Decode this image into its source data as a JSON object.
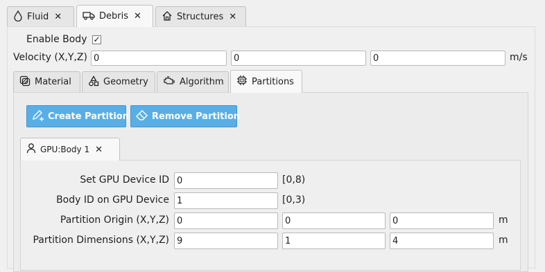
{
  "top_tabs": [
    {
      "label": "Fluid",
      "icon": "droplet-icon",
      "active": false
    },
    {
      "label": "Debris",
      "icon": "truck-icon",
      "active": true
    },
    {
      "label": "Structures",
      "icon": "house-icon",
      "active": false
    }
  ],
  "body": {
    "enable_label": "Enable Body",
    "enable_checked": true,
    "check_glyph": "✓",
    "velocity_label": "Velocity (X,Y,Z)",
    "velocity": [
      "0",
      "0",
      "0"
    ],
    "velocity_unit": "m/s"
  },
  "sub_tabs": [
    {
      "label": "Material",
      "icon": "material-icon",
      "active": false
    },
    {
      "label": "Geometry",
      "icon": "shapes-icon",
      "active": false
    },
    {
      "label": "Algorithm",
      "icon": "engine-icon",
      "active": false
    },
    {
      "label": "Partitions",
      "icon": "chip-icon",
      "active": true
    }
  ],
  "partitions": {
    "create_label": "Create Partition",
    "remove_label": "Remove Partition",
    "partition_tab": {
      "label": "GPU:Body 1",
      "icon": "person-icon"
    },
    "gpu_id_label": "Set GPU Device ID",
    "gpu_id_value": "0",
    "gpu_id_range": "[0,8)",
    "body_id_label": "Body ID on GPU Device",
    "body_id_value": "1",
    "body_id_range": "[0,3)",
    "origin_label": "Partition Origin (X,Y,Z)",
    "origin": [
      "0",
      "0",
      "0"
    ],
    "origin_unit": "m",
    "dims_label": "Partition Dimensions (X,Y,Z)",
    "dims": [
      "9",
      "1",
      "4"
    ],
    "dims_unit": "m"
  },
  "colors": {
    "button_bg": "#5aaee6",
    "button_text": "#ffffff",
    "background": "#f0f0f0"
  }
}
